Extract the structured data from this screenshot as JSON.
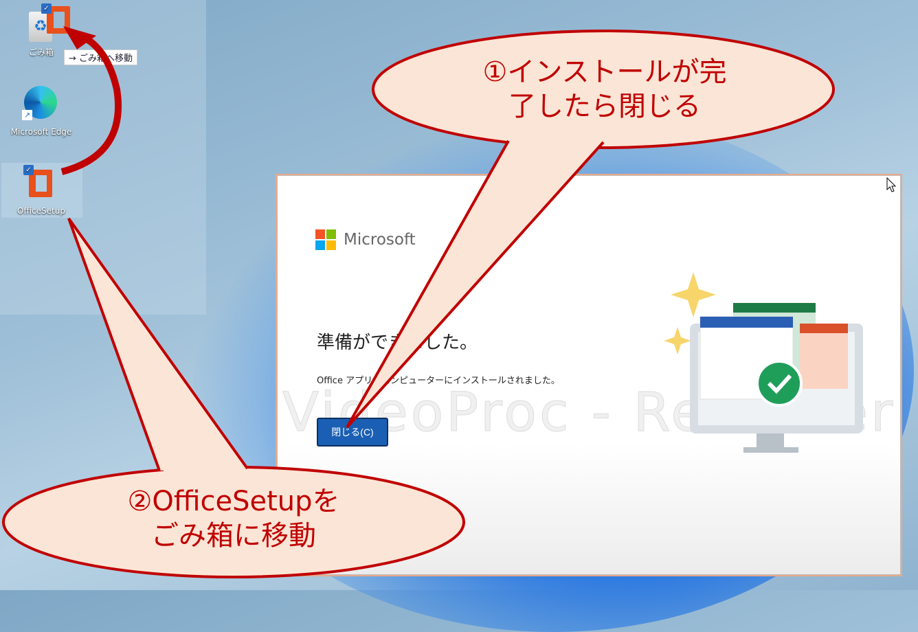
{
  "desktop": {
    "icons": [
      {
        "label": "ごみ箱"
      },
      {
        "label": "Microsoft Edge"
      },
      {
        "label": "OfficeSetup"
      }
    ],
    "drag_tooltip": "→ ごみ箱へ移動"
  },
  "dialog": {
    "brand": "Microsoft",
    "title": "準備ができました。",
    "message": "Office アプリがコンピューターにインストールされました。",
    "close_button": "閉じる(C)",
    "watermark": "VideoProc - Recorder"
  },
  "callouts": [
    {
      "text_line1": "①インストールが完",
      "text_line2": "了したら閉じる"
    },
    {
      "text_line1": "②OfficeSetupを",
      "text_line2": "ごみ箱に移動"
    }
  ],
  "colors": {
    "callout_border": "#c00000",
    "callout_fill": "#fbe5d6",
    "button": "#1a5fb4"
  }
}
